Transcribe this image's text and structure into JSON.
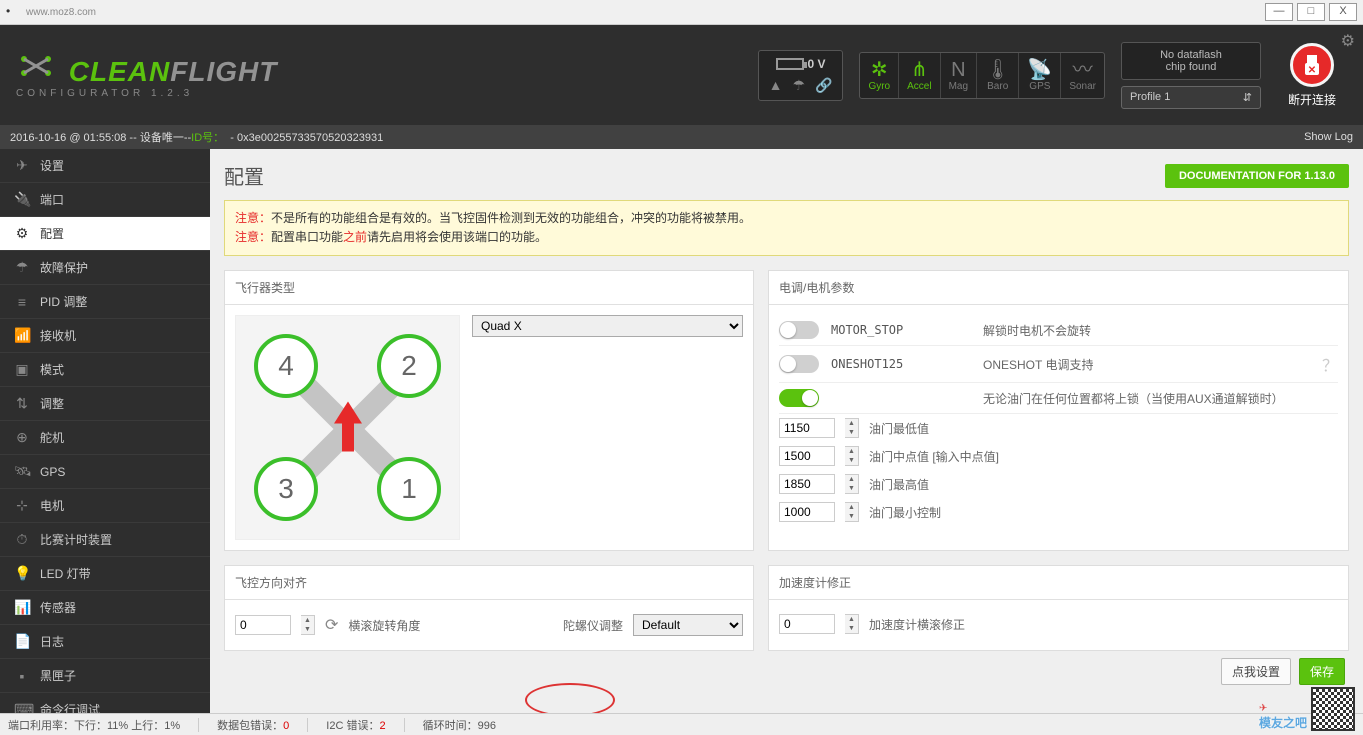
{
  "titlebar": {
    "url": "www.moz8.com"
  },
  "window_buttons": {
    "min": "—",
    "max": "□",
    "close": "X"
  },
  "header": {
    "logo_clean": "CLEAN",
    "logo_flight": "FLIGHT",
    "configurator_label": "CONFIGURATOR  1.2.3",
    "voltage": "0 V",
    "sensors": [
      {
        "label": "Gyro",
        "active": true,
        "icon": "✲"
      },
      {
        "label": "Accel",
        "active": true,
        "icon": "⋔"
      },
      {
        "label": "Mag",
        "active": false,
        "icon": "N"
      },
      {
        "label": "Baro",
        "active": false,
        "icon": "🌡"
      },
      {
        "label": "GPS",
        "active": false,
        "icon": "📡"
      },
      {
        "label": "Sonar",
        "active": false,
        "icon": "〰"
      }
    ],
    "dataflash_line1": "No dataflash",
    "dataflash_line2": "chip found",
    "profile": "Profile 1",
    "disconnect": "断开连接"
  },
  "notif": {
    "timestamp": "2016-10-16 @ 01:55:08",
    "device_label": "设备唯一",
    "id_label": "ID号：",
    "id_value": "- 0x3e00255733570520323931",
    "show_log": "Show Log"
  },
  "sidebar": {
    "items": [
      {
        "icon": "✈",
        "label": "设置"
      },
      {
        "icon": "🔌",
        "label": "端口"
      },
      {
        "icon": "⚙",
        "label": "配置"
      },
      {
        "icon": "☂",
        "label": "故障保护"
      },
      {
        "icon": "≡",
        "label": "PID 调整"
      },
      {
        "icon": "📶",
        "label": "接收机"
      },
      {
        "icon": "▣",
        "label": "模式"
      },
      {
        "icon": "⇅",
        "label": "调整"
      },
      {
        "icon": "⊕",
        "label": "舵机"
      },
      {
        "icon": "🛰",
        "label": "GPS"
      },
      {
        "icon": "⊹",
        "label": "电机"
      },
      {
        "icon": "⏱",
        "label": "比赛计时装置"
      },
      {
        "icon": "💡",
        "label": "LED 灯带"
      },
      {
        "icon": "📊",
        "label": "传感器"
      },
      {
        "icon": "📄",
        "label": "日志"
      },
      {
        "icon": "▪",
        "label": "黑匣子"
      },
      {
        "icon": "⌨",
        "label": "命令行调试"
      }
    ],
    "active_index": 2
  },
  "main": {
    "title": "配置",
    "doc_button": "DOCUMENTATION FOR 1.13.0",
    "notice": {
      "prefix": "注意：",
      "line1": "不是所有的功能组合是有效的。当飞控固件检测到无效的功能组合，冲突的功能将被禁用。",
      "line2a": "配置串口功能",
      "line2b": "之前",
      "line2c": "请先启用将会使用该端口的功能。"
    },
    "aircraft_panel": "飞行器类型",
    "mixer": "Quad X",
    "esc_panel": "电调/电机参数",
    "esc_rows": [
      {
        "on": false,
        "name": "MOTOR_STOP",
        "desc": "解锁时电机不会旋转"
      },
      {
        "on": false,
        "name": "ONESHOT125",
        "desc": "ONESHOT 电调支持"
      },
      {
        "on": true,
        "name": "",
        "desc": "无论油门在任何位置都将上锁（当使用AUX通道解锁时）"
      }
    ],
    "throttle": [
      {
        "val": "1150",
        "label": "油门最低值"
      },
      {
        "val": "1500",
        "label": "油门中点值 [输入中点值]"
      },
      {
        "val": "1850",
        "label": "油门最高值"
      },
      {
        "val": "1000",
        "label": "油门最小控制"
      }
    ],
    "board_align_panel": "飞控方向对齐",
    "board_roll_val": "0",
    "board_roll_label": "横滚旋转角度",
    "gyro_align_label": "陀螺仪调整",
    "gyro_align_val": "Default",
    "accel_panel": "加速度计修正",
    "accel_val": "0",
    "accel_label": "加速度计横滚修正",
    "float_btn_left": "点我设置",
    "float_btn_right": "保存"
  },
  "status": {
    "port_util": "端口利用率：下行：11% 上行：1%",
    "packet_err": "数据包错误：",
    "packet_err_val": "0",
    "i2c_err": "I2C 错误：",
    "i2c_err_val": "2",
    "cycle": "循环时间：",
    "cycle_val": "996"
  },
  "stamp": "模友之吧"
}
